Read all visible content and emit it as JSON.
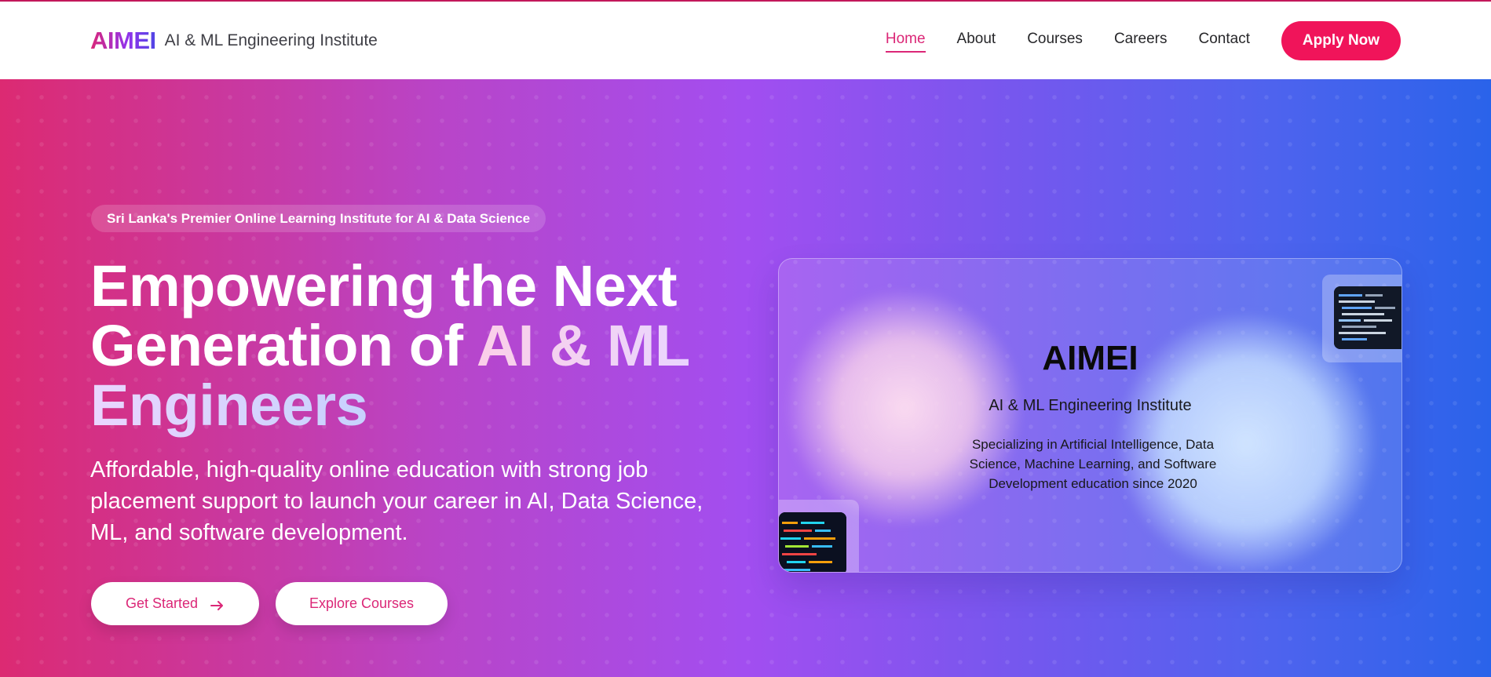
{
  "header": {
    "logo": "AIMEI",
    "subtitle": "AI & ML Engineering Institute",
    "nav": [
      {
        "label": "Home",
        "active": true
      },
      {
        "label": "About"
      },
      {
        "label": "Courses"
      },
      {
        "label": "Careers"
      },
      {
        "label": "Contact"
      }
    ],
    "apply_label": "Apply Now"
  },
  "hero": {
    "badge": "Sri Lanka's Premier Online Learning Institute for AI & Data Science",
    "headline_plain": "Empowering the Next Generation of ",
    "headline_highlight": "AI & ML Engineers",
    "lead": "Affordable, high-quality online education with strong job placement support to launch your career in AI, Data Science, ML, and software development.",
    "primary_cta": "Get Started",
    "primary_cta_icon": "arrow-right-icon",
    "secondary_cta": "Explore Courses"
  },
  "card": {
    "title": "AIMEI",
    "subtitle": "AI & ML Engineering Institute",
    "description": "Specializing in Artificial Intelligence, Data Science, Machine Learning, and Software Development education since 2020"
  },
  "colors": {
    "accent": "#f0145a",
    "active_link": "#db2777",
    "gradient_start": "#dc2a72",
    "gradient_mid": "#a24ef0",
    "gradient_end": "#2a63ea"
  }
}
